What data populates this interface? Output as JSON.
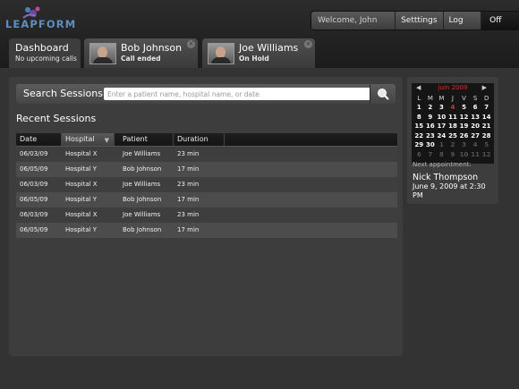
{
  "logo": {
    "text": "LEAPFORM"
  },
  "userbar": {
    "welcome": "Welcome, John Smith",
    "settings": "Setttings",
    "logout": "Log Out",
    "offair": "Off Air"
  },
  "tabs": {
    "dashboard": {
      "name": "Dashboard",
      "status": "No upcoming calls"
    },
    "bob": {
      "name": "Bob Johnson",
      "status": "Call ended"
    },
    "joe": {
      "name": "Joe Williams",
      "status": "On Hold"
    }
  },
  "search": {
    "label": "Search Sessions",
    "placeholder": "Enter a patient name, hospital name, or date",
    "button_icon": "search-icon"
  },
  "recent": {
    "title": "Recent Sessions",
    "columns": [
      "Date",
      "Hospital",
      "Patient",
      "Duration"
    ],
    "sorted_column": "Hospital",
    "rows": [
      [
        "06/03/09",
        "Hospital X",
        "Joe Williams",
        "23 min"
      ],
      [
        "06/05/09",
        "Hospital Y",
        "Bob Johnson",
        "17 min"
      ],
      [
        "06/03/09",
        "Hospital X",
        "Joe Williams",
        "23 min"
      ],
      [
        "06/05/09",
        "Hospital Y",
        "Bob Johnson",
        "17 min"
      ],
      [
        "06/03/09",
        "Hospital X",
        "Joe Williams",
        "23 min"
      ],
      [
        "06/05/09",
        "Hospital Y",
        "Bob Johnson",
        "17 min"
      ]
    ]
  },
  "calendar": {
    "prev": "◀",
    "next": "▶",
    "month": "juin 2009",
    "weekdays": [
      "L",
      "M",
      "M",
      "J",
      "V",
      "S",
      "D"
    ],
    "weeks": [
      [
        "1",
        "2",
        "3",
        "4",
        "5",
        "6",
        "7"
      ],
      [
        "8",
        "9",
        "10",
        "11",
        "12",
        "13",
        "14"
      ],
      [
        "15",
        "16",
        "17",
        "18",
        "19",
        "20",
        "21"
      ],
      [
        "22",
        "23",
        "24",
        "25",
        "26",
        "27",
        "28"
      ],
      [
        "29",
        "30",
        "1",
        "2",
        "3",
        "4",
        "5"
      ],
      [
        "6",
        "7",
        "8",
        "9",
        "10",
        "11",
        "12"
      ]
    ],
    "today": "4",
    "other_month_start": 30
  },
  "next_appointment": {
    "label": "Next appointment:",
    "name": "Nick Thompson",
    "date": "June 9, 2009 at 2:30 PM"
  },
  "colors": {
    "accent_red": "#d93030",
    "logo_blue": "#5f8fc0"
  }
}
